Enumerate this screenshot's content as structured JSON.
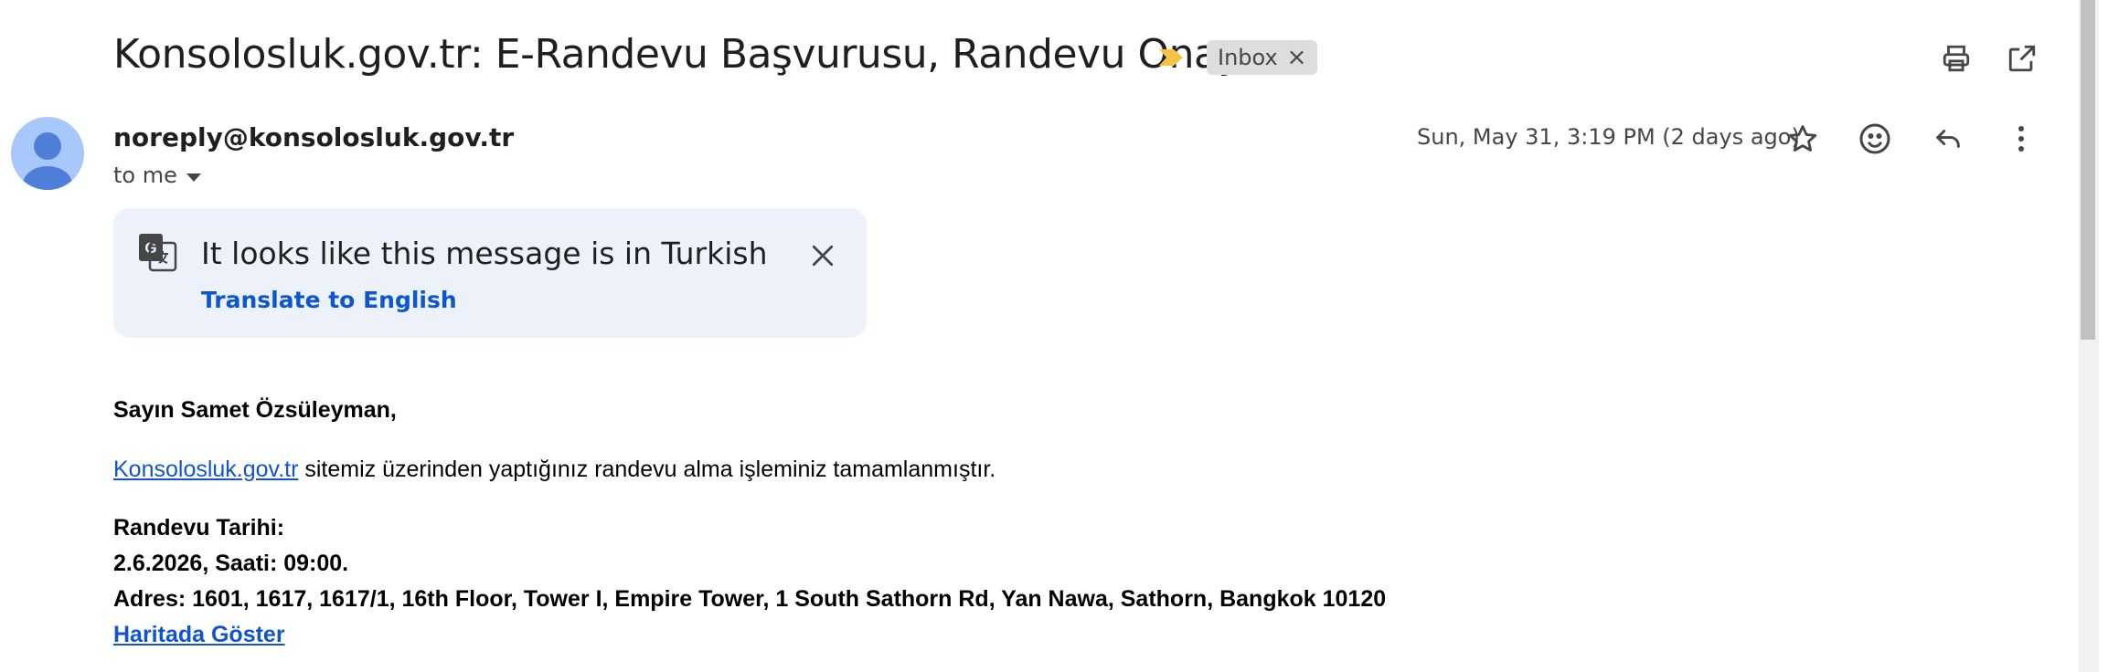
{
  "email": {
    "subject": "Konsolosluk.gov.tr: E-Randevu Başvurusu, Randevu Onay",
    "label": "Inbox",
    "label_remove": "×",
    "sender": "noreply@konsolosluk.gov.tr",
    "recipient": "to me",
    "date": "Sun, May 31, 3:19 PM (2 days ago)"
  },
  "translate_banner": {
    "message": "It looks like this message is in Turkish",
    "action": "Translate to English"
  },
  "body": {
    "greeting": "Sayın Samet Özsüleyman,",
    "site_link": "Konsolosluk.gov.tr",
    "line1_rest": " sitemiz üzerinden yaptığınız randevu alma işleminiz tamamlanmıştır.",
    "date_label": "Randevu Tarihi:",
    "date_time": "2.6.2026, Saati: 09:00.",
    "address": "Adres: 1601, 1617, 1617/1, 16th Floor, Tower I, Empire Tower, 1 South Sathorn Rd, Yan Nawa, Sathorn, Bangkok 10120",
    "map_link": "Haritada Göster"
  },
  "icons": {
    "print": "print-icon",
    "open_new_window": "open-in-new-icon",
    "star": "star-icon",
    "emoji": "emoji-icon",
    "reply": "reply-icon",
    "more": "more-vert-icon",
    "importance": "importance-marker-icon",
    "translate": "translate-icon",
    "close": "close-icon",
    "dropdown": "caret-down-icon"
  },
  "colors": {
    "accent_link": "#0b57d0",
    "body_link": "#1155cc",
    "banner_bg": "#edf1f9",
    "importance": "#f6c344",
    "avatar_bg": "#a8c7fa",
    "avatar_fg": "#4f7fd9"
  }
}
